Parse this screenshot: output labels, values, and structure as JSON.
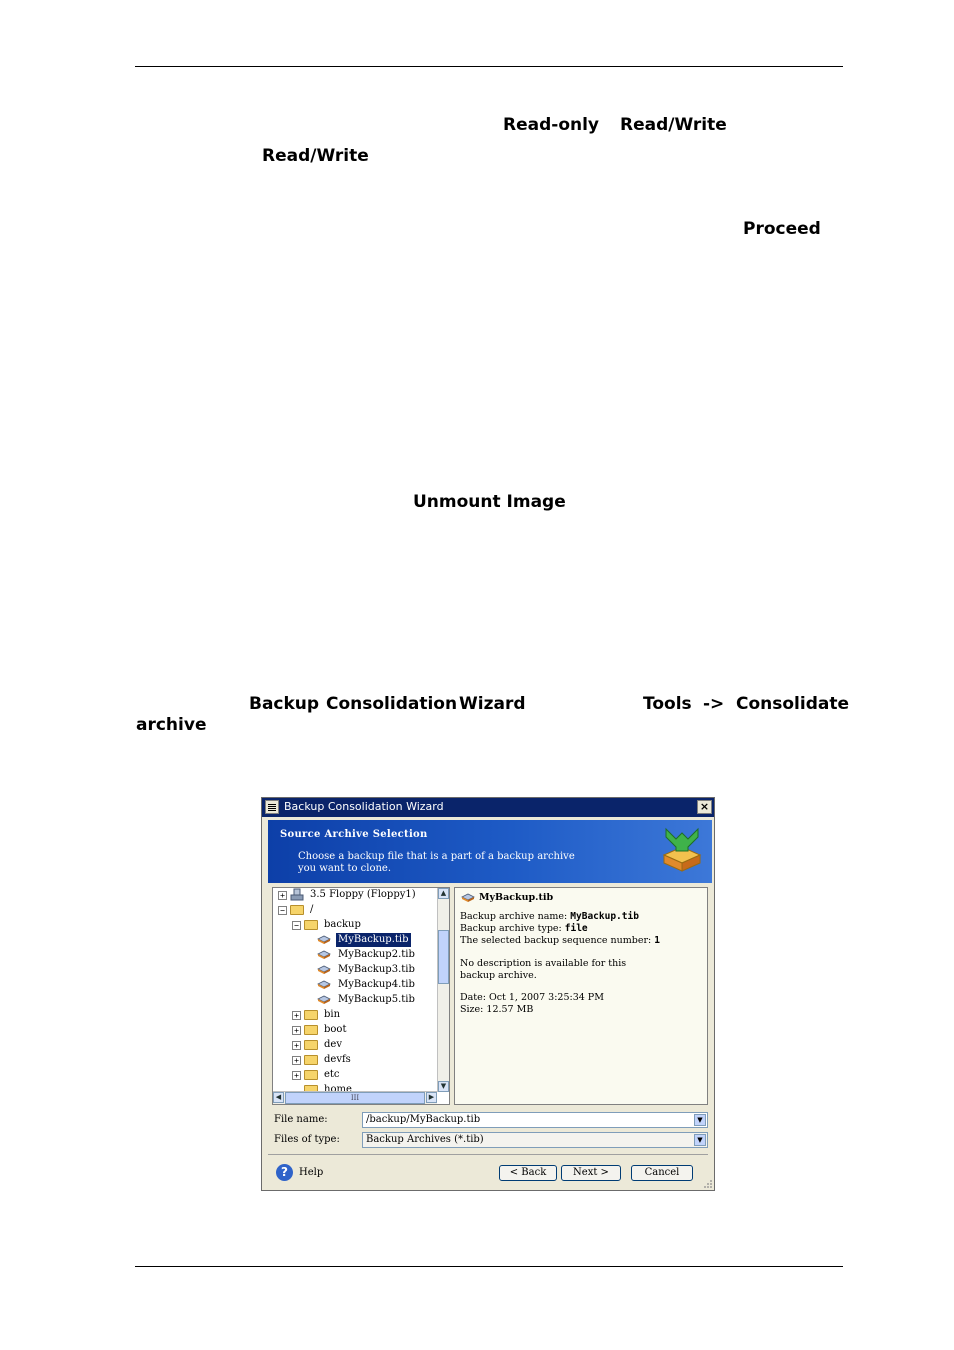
{
  "doc": {
    "readonly": "Read-only",
    "readwrite1": "Read/Write",
    "readwrite2": "Read/Write",
    "proceed": "Proceed",
    "unmount": "Unmount Image",
    "bcw1": "Backup",
    "bcw2": "Consolidation",
    "bcw3": "Wizard",
    "tools": "Tools",
    "arrow": "->",
    "consolidate": "Consolidate",
    "archive": "archive"
  },
  "dialog": {
    "title": "Backup Consolidation Wizard",
    "close": "×",
    "banner_heading": "Source Archive Selection",
    "banner_desc1": "Choose a backup file that is a part of a backup archive",
    "banner_desc2": "you want to clone.",
    "tree": {
      "floppy": "3.5 Floppy (Floppy1)",
      "root": "/",
      "backup": "backup",
      "files": [
        "MyBackup.tib",
        "MyBackup2.tib",
        "MyBackup3.tib",
        "MyBackup4.tib",
        "MyBackup5.tib"
      ],
      "dirs": [
        "bin",
        "boot",
        "dev",
        "devfs",
        "etc",
        "home"
      ]
    },
    "info": {
      "file": "MyBackup.tib",
      "name_label": "Backup archive name:",
      "name_value": "MyBackup.tib",
      "type_label": "Backup archive type:",
      "type_value": "file",
      "seq_label": "The selected backup sequence number:",
      "seq_value": "1",
      "desc1": "No description is available for this",
      "desc2": "backup archive.",
      "date": "Date: Oct 1, 2007 3:25:34 PM",
      "size": "Size: 12.57 MB"
    },
    "filename_label": "File name:",
    "filename_value": "/backup/MyBackup.tib",
    "filetype_label": "Files of type:",
    "filetype_value": "Backup Archives (*.tib)",
    "help": "Help",
    "back": "< Back",
    "next": "Next >",
    "cancel": "Cancel",
    "scroll_grip": "III"
  }
}
